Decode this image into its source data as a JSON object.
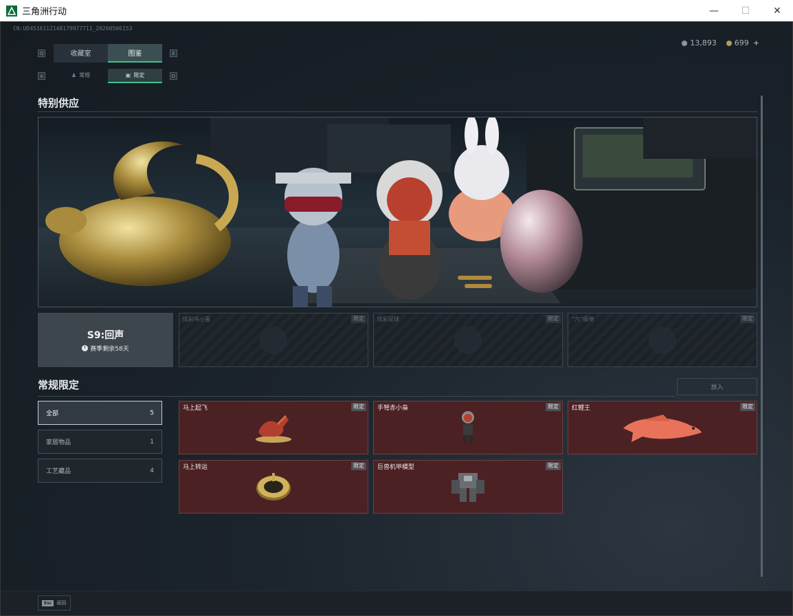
{
  "window": {
    "title": "三角洲行动",
    "minimize": "—",
    "maximize": "☐",
    "close": "✕"
  },
  "header": {
    "id_text": "CN:UD4516112148179977711_20260506153",
    "currency_silver": "13,893",
    "currency_gold": "699",
    "plus": "+"
  },
  "tabs": {
    "key_left": "Q",
    "key_right": "E",
    "main": [
      "收藏室",
      "图鉴"
    ],
    "active_main": 1,
    "sub_key_left": "A",
    "sub_key_right": "D",
    "sub": [
      "常规",
      "限定"
    ],
    "active_sub": 1
  },
  "special": {
    "title": "特别供应",
    "season_name": "S9:回声",
    "season_remaining": "赛季剩余58天",
    "locked": [
      {
        "name": "炫彩鸟小蛋",
        "tag": "限定"
      },
      {
        "name": "炫彩足球",
        "tag": "限定"
      },
      {
        "name": "“六”级弹",
        "tag": "限定"
      }
    ]
  },
  "regular": {
    "title": "常规限定",
    "put_label": "放入",
    "filters": [
      {
        "label": "全部",
        "count": "5"
      },
      {
        "label": "家居物品",
        "count": "1"
      },
      {
        "label": "工艺藏品",
        "count": "4"
      }
    ],
    "items": [
      {
        "name": "马上起飞",
        "tag": "限定",
        "icon": "horse-figurine-icon"
      },
      {
        "name": "手弩赤小枭",
        "tag": "限定",
        "icon": "figure-icon"
      },
      {
        "name": "红鲤王",
        "tag": "限定",
        "icon": "carp-icon"
      },
      {
        "name": "马上转运",
        "tag": "限定",
        "icon": "golden-disc-icon"
      },
      {
        "name": "巨兽机甲模型",
        "tag": "限定",
        "icon": "mech-model-icon"
      }
    ]
  },
  "footer": {
    "esc_key": "Esc",
    "back_label": "返回"
  },
  "colors": {
    "accent": "#3ec38b",
    "item_bg": "#4b2124"
  }
}
